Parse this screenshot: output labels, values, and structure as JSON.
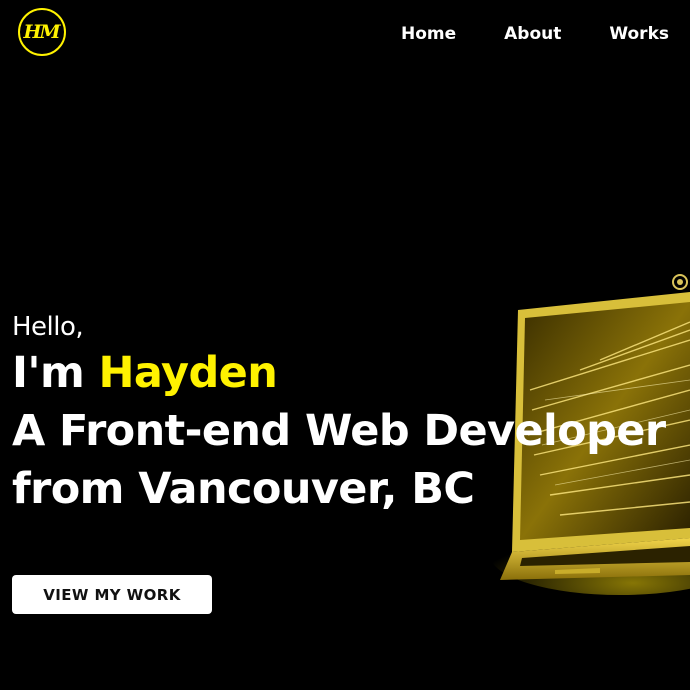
{
  "logo": {
    "text": "HM"
  },
  "nav": {
    "items": [
      {
        "label": "Home"
      },
      {
        "label": "About"
      },
      {
        "label": "Works"
      }
    ]
  },
  "hero": {
    "greeting": "Hello,",
    "intro_prefix": "I'm ",
    "name": "Hayden",
    "line2": "A Front-end Web Developer",
    "line3": "from Vancouver, BC",
    "cta_label": "VIEW MY WORK"
  },
  "colors": {
    "background": "#000000",
    "accent": "#fff200",
    "text": "#ffffff",
    "button_bg": "#ffffff",
    "button_text": "#111111"
  }
}
